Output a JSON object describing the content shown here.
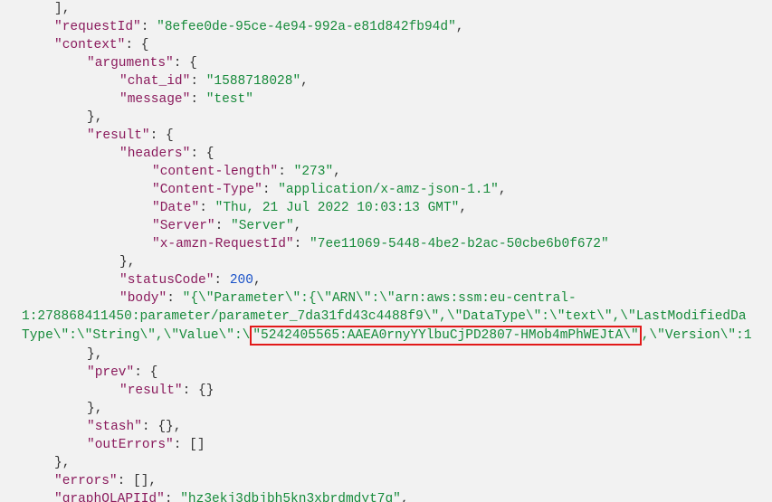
{
  "lines": {
    "close_bracket": "],",
    "requestId_key": "\"requestId\"",
    "requestId_val": "\"8efee0de-95ce-4e94-992a-e81d842fb94d\"",
    "context_key": "\"context\"",
    "arguments_key": "\"arguments\"",
    "chat_id_key": "\"chat_id\"",
    "chat_id_val": "\"1588718028\"",
    "message_key": "\"message\"",
    "message_val": "\"test\"",
    "result_key": "\"result\"",
    "headers_key": "\"headers\"",
    "content_length_key": "\"content-length\"",
    "content_length_val": "\"273\"",
    "content_type_key": "\"Content-Type\"",
    "content_type_val": "\"application/x-amz-json-1.1\"",
    "date_key": "\"Date\"",
    "date_val": "\"Thu, 21 Jul 2022 10:03:13 GMT\"",
    "server_key": "\"Server\"",
    "server_val": "\"Server\"",
    "xamzn_key": "\"x-amzn-RequestId\"",
    "xamzn_val": "\"7ee11069-5448-4be2-b2ac-50cbe6b0f672\"",
    "statusCode_key": "\"statusCode\"",
    "statusCode_val": "200",
    "body_key": "\"body\"",
    "body_pre": "\"{\\\"Parameter\\\":{\\\"ARN\\\":\\\"arn:aws:ssm:eu-central-",
    "body_line2a": "1:278868411450:parameter/parameter_7da31fd43c4488f9\\\",\\\"DataType\\\":\\\"text\\\",\\\"LastModifiedDa",
    "body_line3a": "Type\\\":\\\"String\\\",\\\"Value\\\":\\",
    "body_highlight": "\"5242405565:AAEA0rnyYYlbuCjPD2807-HMob4mPhWEJtA\\\"",
    "body_line3c": ",\\\"Version\\\":1",
    "prev_key": "\"prev\"",
    "prev_result_key": "\"result\"",
    "stash_key": "\"stash\"",
    "outErrors_key": "\"outErrors\"",
    "errors_key": "\"errors\"",
    "graphql_key": "\"graphQLAPIId\"",
    "graphql_val": "\"hz3ekj3dbjbh5kn3xbrdmdyt7q\""
  }
}
